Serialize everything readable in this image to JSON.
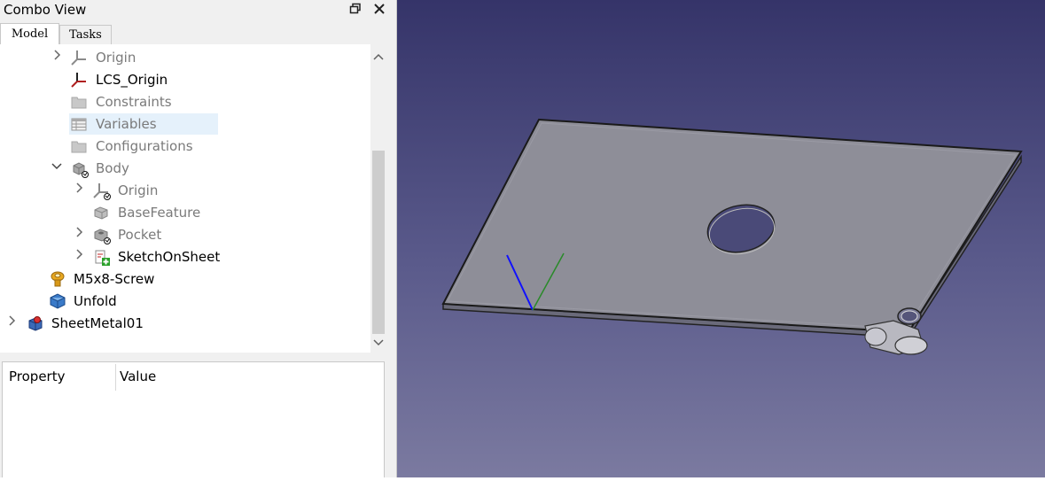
{
  "panel": {
    "title": "Combo View",
    "restore_icon": "restore-icon",
    "close_icon": "close-icon"
  },
  "tabs": [
    {
      "label": "Model",
      "active": true
    },
    {
      "label": "Tasks",
      "active": false
    }
  ],
  "tree": [
    {
      "label": "Origin",
      "icon": "origin-axes-icon",
      "expander": "collapsed",
      "grayed": true
    },
    {
      "label": "LCS_Origin",
      "icon": "lcs-icon",
      "expander": "none",
      "grayed": false
    },
    {
      "label": "Constraints",
      "icon": "folder-icon",
      "expander": "none",
      "grayed": true
    },
    {
      "label": "Variables",
      "icon": "spreadsheet-icon",
      "expander": "none",
      "grayed": true,
      "selected": true
    },
    {
      "label": "Configurations",
      "icon": "folder-icon",
      "expander": "none",
      "grayed": true
    },
    {
      "label": "Body",
      "icon": "body-icon",
      "expander": "expanded",
      "grayed": true
    },
    {
      "label": "Origin",
      "icon": "origin-axes-icon",
      "expander": "collapsed",
      "grayed": true
    },
    {
      "label": "BaseFeature",
      "icon": "feature-icon",
      "expander": "none",
      "grayed": true
    },
    {
      "label": "Pocket",
      "icon": "pocket-icon",
      "expander": "collapsed",
      "grayed": true
    },
    {
      "label": "SketchOnSheet",
      "icon": "sketch-icon",
      "expander": "collapsed",
      "grayed": false
    },
    {
      "label": "M5x8-Screw",
      "icon": "screw-icon",
      "expander": "none",
      "grayed": false
    },
    {
      "label": "Unfold",
      "icon": "cube-icon",
      "expander": "none",
      "grayed": false
    },
    {
      "label": "SheetMetal01",
      "icon": "part-icon",
      "expander": "collapsed",
      "grayed": false
    }
  ],
  "properties": {
    "col_property": "Property",
    "col_value": "Value"
  },
  "colors": {
    "viewport_top": "#353469",
    "viewport_bottom": "#7b7aa0",
    "selection": "#e5f1fb",
    "axis_x": "#1010ff",
    "axis_y": "#2a8a2a"
  }
}
